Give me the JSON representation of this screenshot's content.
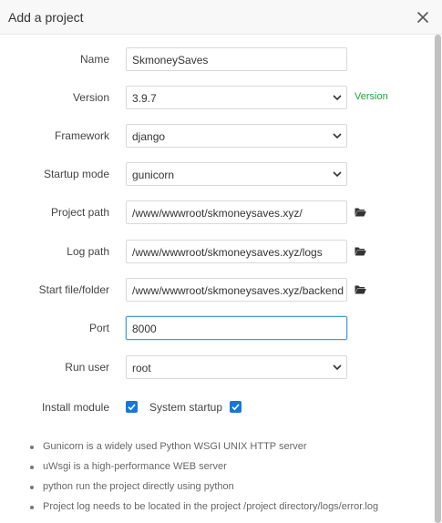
{
  "dialog": {
    "title": "Add a project",
    "close_icon": "close-icon"
  },
  "form": {
    "name": {
      "label": "Name",
      "value": "SkmoneySaves"
    },
    "version": {
      "label": "Version",
      "value": "3.9.7",
      "hint": "Version"
    },
    "framework": {
      "label": "Framework",
      "value": "django"
    },
    "startup_mode": {
      "label": "Startup mode",
      "value": "gunicorn"
    },
    "project_path": {
      "label": "Project path",
      "value": "/www/wwwroot/skmoneysaves.xyz/"
    },
    "log_path": {
      "label": "Log path",
      "value": "/www/wwwroot/skmoneysaves.xyz/logs"
    },
    "start_file": {
      "label": "Start file/folder",
      "value": "/www/wwwroot/skmoneysaves.xyz/backend"
    },
    "port": {
      "label": "Port",
      "value": "8000"
    },
    "run_user": {
      "label": "Run user",
      "value": "root"
    },
    "install_module": {
      "label": "Install module",
      "checked": true
    },
    "system_startup": {
      "label": "System startup",
      "checked": true
    }
  },
  "notes": [
    "Gunicorn is a widely used Python WSGI UNIX HTTP server",
    "uWsgi is a high-performance WEB server",
    "python run the project directly using python",
    "Project log needs to be located in the project /project directory/logs/error.log"
  ],
  "colors": {
    "accent": "#1677d9",
    "hint_green": "#20a53a",
    "focus_border": "#4c9cd8"
  },
  "icons": {
    "folder": "folder-open-icon",
    "dropdown": "chevron-down-icon",
    "check": "checkmark-icon"
  }
}
